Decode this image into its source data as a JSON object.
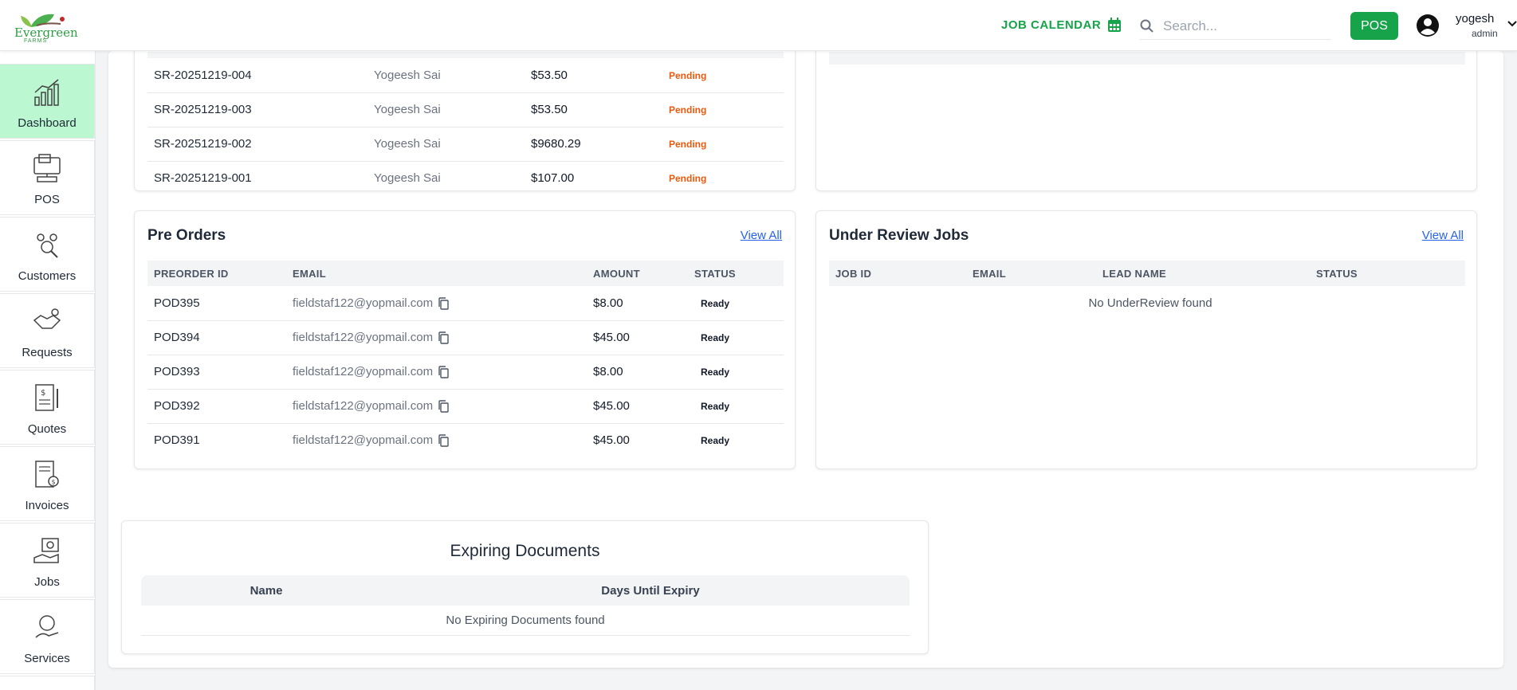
{
  "header": {
    "logo_text": "Evergreen",
    "logo_sub": "FARMS",
    "job_calendar_label": "JOB CALENDAR",
    "search_placeholder": "Search...",
    "pos_label": "POS",
    "user_name": "yogesh",
    "user_role": "admin"
  },
  "sidebar": {
    "items": [
      {
        "label": "Dashboard",
        "icon": "chart-bar-icon",
        "active": true
      },
      {
        "label": "POS",
        "icon": "pos-terminal-icon"
      },
      {
        "label": "Customers",
        "icon": "customers-icon"
      },
      {
        "label": "Requests",
        "icon": "handshake-icon"
      },
      {
        "label": "Quotes",
        "icon": "quote-document-icon"
      },
      {
        "label": "Invoices",
        "icon": "invoice-icon"
      },
      {
        "label": "Jobs",
        "icon": "jobs-icon"
      },
      {
        "label": "Services",
        "icon": "services-icon"
      }
    ]
  },
  "service_requests": {
    "rows": [
      {
        "id": "SR-20251219-004",
        "name": "Yogeesh Sai",
        "amount": "$53.50",
        "status": "Pending"
      },
      {
        "id": "SR-20251219-003",
        "name": "Yogeesh Sai",
        "amount": "$53.50",
        "status": "Pending"
      },
      {
        "id": "SR-20251219-002",
        "name": "Yogeesh Sai",
        "amount": "$9680.29",
        "status": "Pending"
      },
      {
        "id": "SR-20251219-001",
        "name": "Yogeesh Sai",
        "amount": "$107.00",
        "status": "Pending"
      }
    ]
  },
  "pre_orders": {
    "title": "Pre Orders",
    "view_all": "View All",
    "columns": [
      "PREORDER ID",
      "EMAIL",
      "AMOUNT",
      "STATUS"
    ],
    "rows": [
      {
        "id": "POD395",
        "email": "fieldstaf122@yopmail.com",
        "amount": "$8.00",
        "status": "Ready"
      },
      {
        "id": "POD394",
        "email": "fieldstaf122@yopmail.com",
        "amount": "$45.00",
        "status": "Ready"
      },
      {
        "id": "POD393",
        "email": "fieldstaf122@yopmail.com",
        "amount": "$8.00",
        "status": "Ready"
      },
      {
        "id": "POD392",
        "email": "fieldstaf122@yopmail.com",
        "amount": "$45.00",
        "status": "Ready"
      },
      {
        "id": "POD391",
        "email": "fieldstaf122@yopmail.com",
        "amount": "$45.00",
        "status": "Ready"
      }
    ]
  },
  "under_review": {
    "title": "Under Review Jobs",
    "view_all": "View All",
    "columns": [
      "JOB ID",
      "EMAIL",
      "LEAD NAME",
      "STATUS"
    ],
    "empty": "No UnderReview found"
  },
  "expiring_documents": {
    "title": "Expiring Documents",
    "columns": [
      "Name",
      "Days Until Expiry"
    ],
    "empty": "No Expiring Documents found"
  },
  "colors": {
    "accent": "#16a34a",
    "active_sidebar": "#bbf7d0",
    "pending": "#ea580c",
    "link": "#2563eb"
  }
}
